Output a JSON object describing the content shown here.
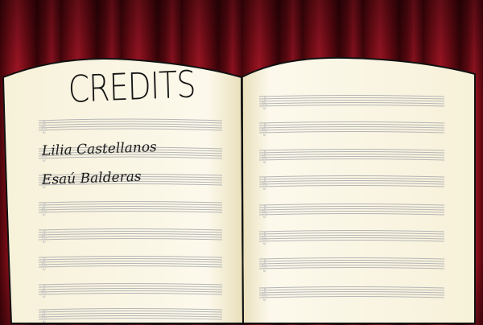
{
  "screen": {
    "title": "CREDITS",
    "names": [
      "Lilia Castellanos",
      "Esaú Balderas"
    ]
  },
  "colors": {
    "curtain": "#8a0f1a",
    "paper": "#fbf7e6",
    "staff_lines": "#b5b5b5",
    "ink": "#141414"
  }
}
